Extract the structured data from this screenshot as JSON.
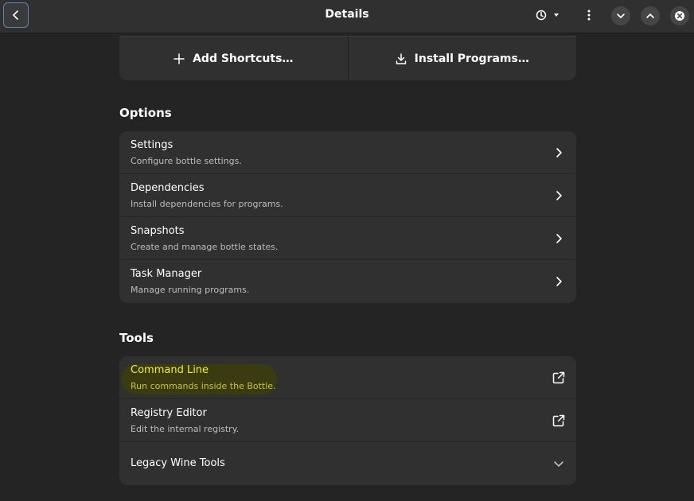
{
  "header": {
    "title": "Details"
  },
  "actions": {
    "add_shortcuts": "Add Shortcuts…",
    "install_programs": "Install Programs…"
  },
  "options": {
    "heading": "Options",
    "items": [
      {
        "title": "Settings",
        "subtitle": "Configure bottle settings."
      },
      {
        "title": "Dependencies",
        "subtitle": "Install dependencies for programs."
      },
      {
        "title": "Snapshots",
        "subtitle": "Create and manage bottle states."
      },
      {
        "title": "Task Manager",
        "subtitle": "Manage running programs."
      }
    ]
  },
  "tools": {
    "heading": "Tools",
    "items": [
      {
        "title": "Command Line",
        "subtitle": "Run commands inside the Bottle."
      },
      {
        "title": "Registry Editor",
        "subtitle": "Edit the internal registry."
      },
      {
        "title": "Legacy Wine Tools"
      }
    ]
  },
  "colors": {
    "highlight_text": "#f0ef2c",
    "focus_border": "#5d86b8"
  }
}
